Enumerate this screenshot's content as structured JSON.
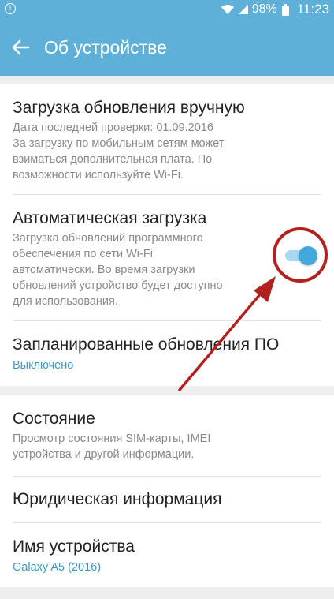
{
  "status_bar": {
    "battery": "98%",
    "time": "11:23",
    "left_icon": "circle-alert-icon",
    "icons": [
      "wifi-icon",
      "signal-icon",
      "battery-icon"
    ]
  },
  "app_bar": {
    "title": "Об устройстве",
    "back_icon": "arrow-left-icon"
  },
  "items": [
    {
      "title": "Загрузка обновления вручную",
      "subtitle_lines": [
        "Дата последней проверки: 01.09.2016",
        "За загрузку по мобильным сетям может",
        "взиматься дополнительная плата. По",
        "возможности используйте Wi-Fi."
      ]
    },
    {
      "title": "Автоматическая загрузка",
      "subtitle_lines": [
        "Загрузка обновлений программного",
        "обеспечения по сети Wi-Fi",
        "автоматически. Во время загрузки",
        "обновлений устройство будет доступно",
        "для использования."
      ],
      "toggle_on": true
    },
    {
      "title": "Запланированные обновления ПО",
      "value": "Выключено"
    },
    {
      "title": "Состояние",
      "subtitle_lines": [
        "Просмотр состояния SIM-карты, IMEI",
        "устройства и другой информации."
      ]
    },
    {
      "title": "Юридическая информация"
    },
    {
      "title": "Имя устройства",
      "value": "Galaxy A5 (2016)"
    }
  ],
  "colors": {
    "app_bar": "#5eb0d8",
    "accent": "#3a98c7",
    "annotation": "#b3211f",
    "toggle_thumb": "#43a8dc",
    "toggle_track": "#a8d7ef"
  }
}
